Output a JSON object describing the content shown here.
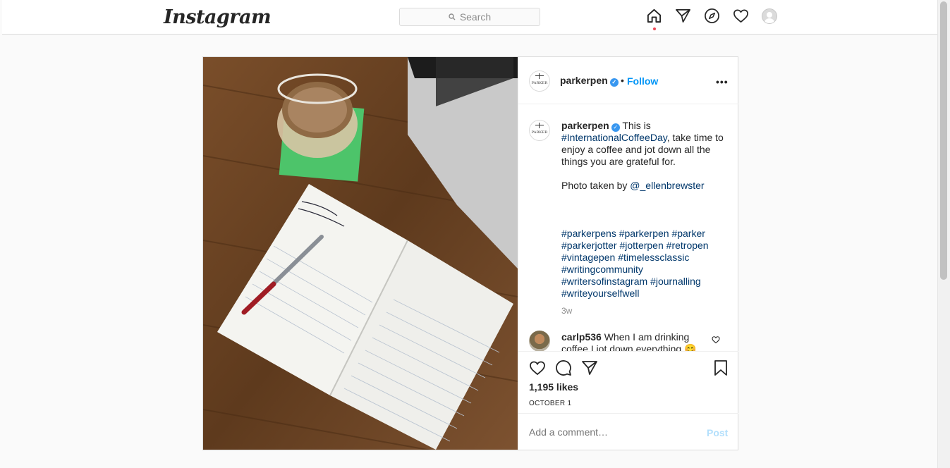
{
  "nav": {
    "logo": "Instagram",
    "search_placeholder": "Search",
    "icons": [
      "home-icon",
      "direct-icon",
      "explore-icon",
      "activity-icon",
      "profile-avatar"
    ]
  },
  "post": {
    "author": "parkerpen",
    "author_avatar_text": "PARKER",
    "header_separator": "•",
    "follow_label": "Follow",
    "more_label": "•••",
    "caption": {
      "username": "parkerpen",
      "text_1": "This is",
      "hashtag_1": "#InternationalCoffeeDay",
      "text_2": ", take time to enjoy a coffee and jot down all the things you are grateful for.",
      "photo_credit_prefix": "Photo taken by",
      "photo_credit_user": "@_ellenbrewster",
      "hashtags": [
        "#parkerpens",
        "#parkerpen",
        "#parker",
        "#parkerjotter",
        "#jotterpen",
        "#retropen",
        "#vintagepen",
        "#timelessclassic",
        "#writingcommunity",
        "#writersofinstagram",
        "#journalling",
        "#writeyourselfwell"
      ],
      "time": "3w"
    },
    "comment": {
      "username": "carlp536",
      "text": "When I am drinking coffee I jot down everything 😊"
    },
    "likes": "1,195 likes",
    "date": "OCTOBER 1",
    "comment_placeholder": "Add a comment…",
    "post_label": "Post"
  },
  "colors": {
    "link": "#0095f6",
    "hashtag": "#00376b",
    "post_disabled": "#b2dffc",
    "notification": "#ed4956"
  }
}
